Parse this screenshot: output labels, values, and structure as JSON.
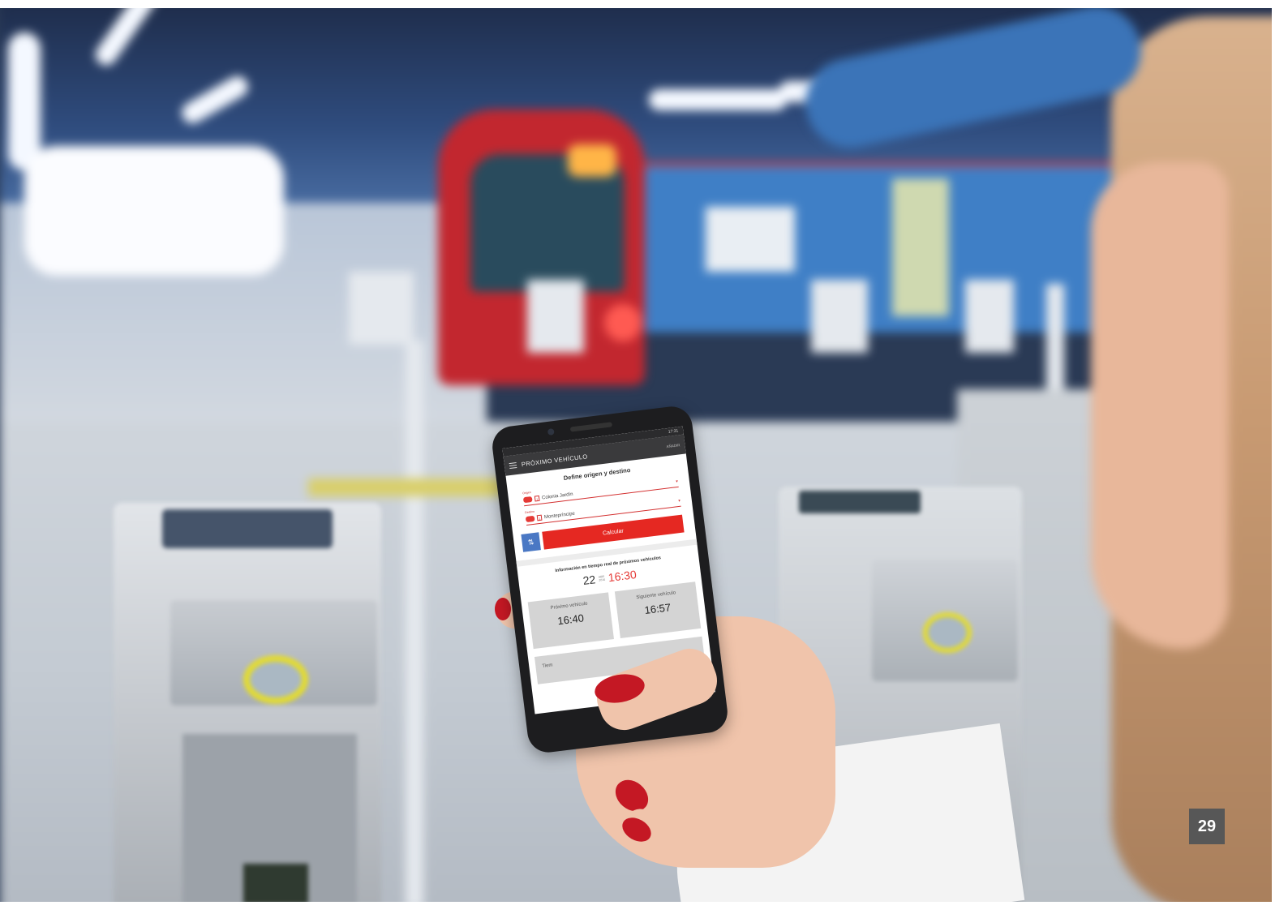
{
  "phone_app": {
    "status_time": "17:31",
    "header_title": "PRÓXIMO VEHÍCULO",
    "header_action": "AÑADIR",
    "form_title": "Define origen y destino",
    "origin": {
      "label": "Origen",
      "line": "1",
      "value": "Colonia Jardín"
    },
    "destination": {
      "label": "Destino",
      "line": "1",
      "value": "Montepríncipe"
    },
    "swap_icon": "swap-arrows-icon",
    "calculate_button": "Calcular",
    "realtime_info": "Información en tiempo real de próximos vehículos",
    "date_day": "22",
    "date_month": "ABR",
    "date_year": "2016",
    "current_time": "16:30",
    "next_vehicle": {
      "label": "Próximo vehículo",
      "time": "16:40"
    },
    "following_vehicle": {
      "label": "Siguiente vehículo",
      "time": "16:57"
    },
    "travel_time_partial": "Tiem"
  },
  "page_number": "29",
  "colors": {
    "accent_red": "#e52822",
    "swap_blue": "#4a78c4",
    "badge_gray": "#575757"
  }
}
